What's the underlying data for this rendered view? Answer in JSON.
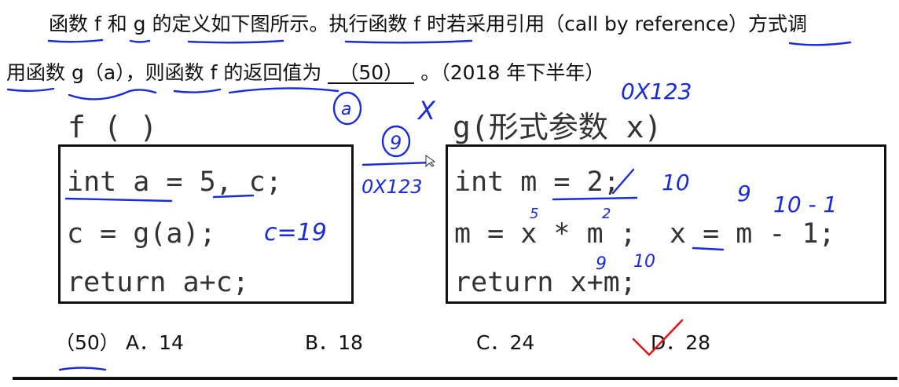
{
  "question": {
    "line1": "函数 f 和 g 的定义如下图所示。执行函数 f 时若采用引用（call by reference）方式调",
    "line2_before": "用函数 g（a），则函数 f 的返回值为",
    "blank": "（50）",
    "line2_after": "。（2018 年下半年）"
  },
  "function_f": {
    "header": "f ( )",
    "code": [
      "int a = 5, c;",
      "c = g(a);",
      "return a+c;"
    ]
  },
  "function_g": {
    "header": "g(形式参数 x)",
    "code": [
      "int m = 2;",
      "m = x * m ;  x = m - 1;",
      "return x+m;"
    ]
  },
  "options": {
    "number": "（50）",
    "a": "A．14",
    "b": "B．18",
    "c": "C．24",
    "d": "D．28"
  },
  "handwriting": {
    "addr_top": "0X123",
    "addr_mid": "0X123",
    "circle_a": "a",
    "circle_9": "9",
    "cross": "X",
    "c_value": "c=19",
    "m_new": "10",
    "x_new_top": "9",
    "m_minus": "10 - 1",
    "x_sub": "5",
    "m_sub": "2",
    "ret_x": "9",
    "ret_m": "10"
  },
  "colors": {
    "pen": "#1a2bd8",
    "check": "#e01818",
    "text": "#111111"
  }
}
